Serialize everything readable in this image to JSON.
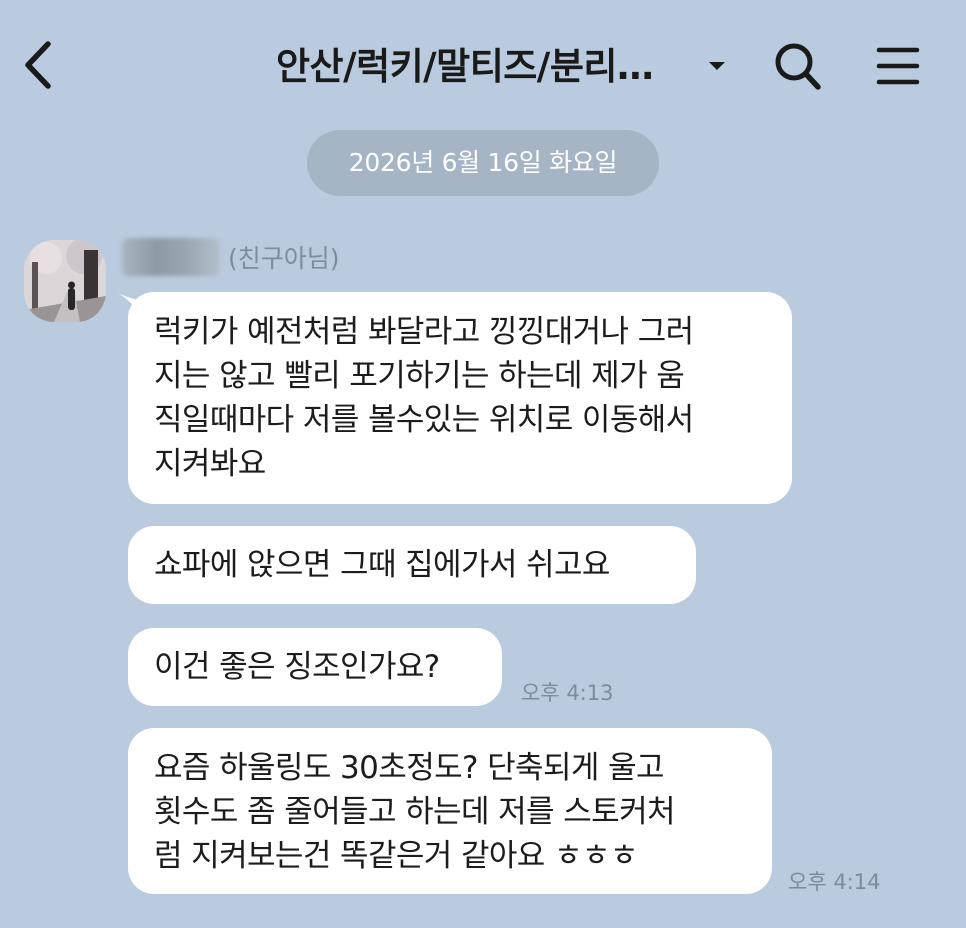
{
  "header": {
    "title": "안산/럭키/말티즈/분리…",
    "back_icon": "chevron-left-icon",
    "caret_icon": "caret-down-icon",
    "search_icon": "search-icon",
    "menu_icon": "hamburger-menu-icon"
  },
  "date_divider": "2026년 6월 16일 화요일",
  "sender": {
    "status": "(친구아님)"
  },
  "messages": [
    {
      "text": "럭키가 예전처럼 봐달라고 낑낑대거나 그러\n지는 않고 빨리 포기하기는 하는데 제가 움\n직일때마다 저를 볼수있는 위치로 이동해서\n 지켜봐요"
    },
    {
      "text": "쇼파에 앉으면 그때 집에가서 쉬고요"
    },
    {
      "text": "이건 좋은 징조인가요?",
      "time": "오후 4:13"
    },
    {
      "text": "요즘 하울링도 30초정도? 단축되게 울고\n횟수도 좀 줄어들고 하는데 저를 스토커처\n럼 지켜보는건 똑같은거 같아요 ㅎㅎㅎ",
      "time": "오후 4:14"
    }
  ],
  "colors": {
    "background": "#bacbdf",
    "bubble": "#ffffff",
    "date_pill": "#a6b5c6",
    "timestamp": "#7d8b9b"
  }
}
